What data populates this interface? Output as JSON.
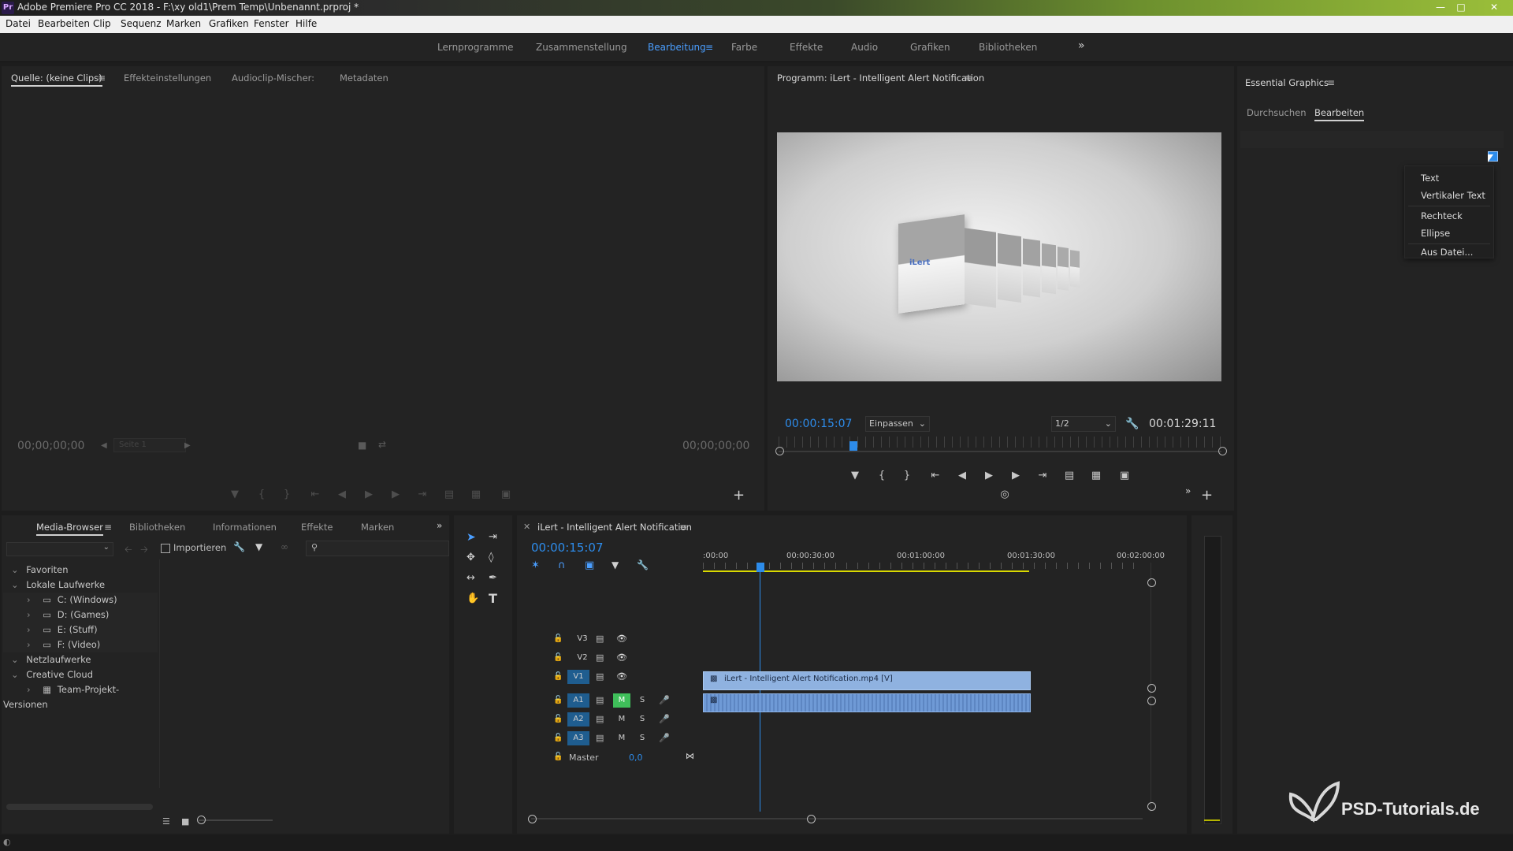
{
  "window": {
    "title": "Adobe Premiere Pro CC 2018 - F:\\xy old1\\Prem Temp\\Unbenannt.prproj *",
    "app_icon": "Pr"
  },
  "menubar": [
    "Datei",
    "Bearbeiten",
    "Clip",
    "Sequenz",
    "Marken",
    "Grafiken",
    "Fenster",
    "Hilfe"
  ],
  "workspaces": {
    "tabs": [
      "Lernprogramme",
      "Zusammenstellung",
      "Bearbeitung",
      "Farbe",
      "Effekte",
      "Audio",
      "Grafiken",
      "Bibliotheken"
    ],
    "active": "Bearbeitung",
    "more": "»"
  },
  "source_panel": {
    "tabs": [
      "Quelle: (keine Clips)",
      "Effekteinstellungen",
      "Audioclip-Mischer:",
      "Metadaten"
    ],
    "timecode_left": "00;00;00;00",
    "timecode_right": "00;00;00;00",
    "page_select": "Seite 1"
  },
  "program_panel": {
    "title": "Programm: iLert - Intelligent Alert Notification",
    "current_timecode": "00:00:15:07",
    "fit_select": "Einpassen",
    "resolution_select": "1/2",
    "duration": "00:01:29:11",
    "preview_logo_text": "iLert"
  },
  "essential_graphics": {
    "title": "Essential Graphics",
    "tabs": [
      "Durchsuchen",
      "Bearbeiten"
    ],
    "active_tab": "Bearbeiten",
    "new_layer_menu": [
      "Text",
      "Vertikaler Text",
      "Rechteck",
      "Ellipse",
      "Aus Datei..."
    ]
  },
  "media_browser": {
    "tabs": [
      "Media-Browser",
      "Bibliotheken",
      "Informationen",
      "Effekte",
      "Marken"
    ],
    "import_label": "Importieren",
    "tree": [
      {
        "label": "Favoriten",
        "level": 0
      },
      {
        "label": "Lokale Laufwerke",
        "level": 0
      },
      {
        "label": "C: (Windows)",
        "level": 1
      },
      {
        "label": "D: (Games)",
        "level": 1
      },
      {
        "label": "E: (Stuff)",
        "level": 1
      },
      {
        "label": "F: (Video)",
        "level": 1
      },
      {
        "label": "Netzlaufwerke",
        "level": 0
      },
      {
        "label": "Creative Cloud",
        "level": 0
      },
      {
        "label": "Team-Projekt-Versionen",
        "level": 1
      }
    ]
  },
  "timeline": {
    "sequence_name": "iLert - Intelligent Alert Notification",
    "current_timecode": "00:00:15:07",
    "ruler_labels": [
      ":00:00",
      "00:00:30:00",
      "00:01:00:00",
      "00:01:30:00",
      "00:02:00:00"
    ],
    "video_tracks": [
      "V3",
      "V2",
      "V1"
    ],
    "audio_tracks": [
      "A1",
      "A2",
      "A3"
    ],
    "track_m": "M",
    "track_s": "S",
    "master_label": "Master",
    "master_value": "0,0",
    "video_clip_label": "iLert - Intelligent Alert Notification.mp4 [V]"
  },
  "watermark": {
    "text": "PSD-Tutorials.de"
  },
  "colors": {
    "accent_blue": "#2d8ceb",
    "clip_video": "#8fb2e0",
    "clip_audio": "#6f9ad6",
    "m_active": "#3fbf5a"
  }
}
